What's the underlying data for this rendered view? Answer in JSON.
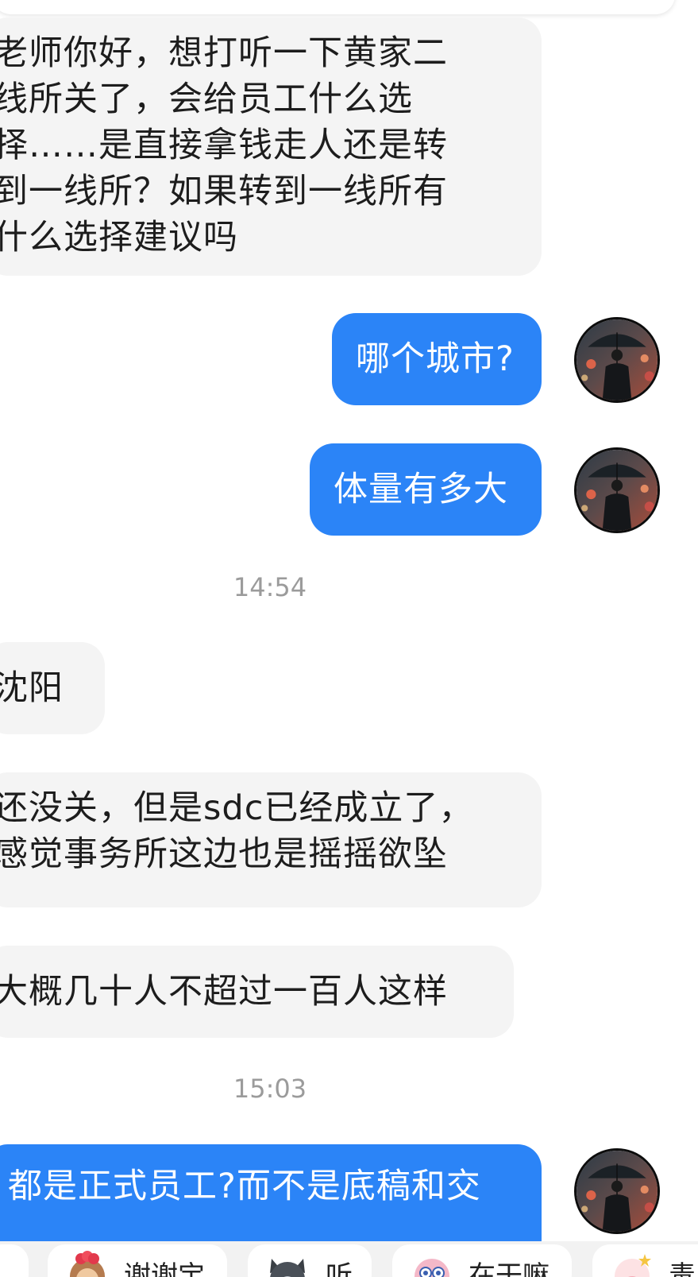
{
  "messages": {
    "m1": {
      "lines": [
        "老师你好，想打听一下黄家二",
        "线所关了，会给员工什么选",
        "择……是直接拿钱走人还是转",
        "到一线所？如果转到一线所有",
        "什么选择建议吗"
      ]
    },
    "m2": {
      "text": "哪个城市?"
    },
    "m3": {
      "text": "体量有多大"
    },
    "time1": "14:54",
    "m4": {
      "text": "沈阳"
    },
    "m5": {
      "lines": [
        "还没关，但是sdc已经成立了，",
        "感觉事务所这边也是摇摇欲坠"
      ]
    },
    "m6": {
      "text": "大概几十人不超过一百人这样"
    },
    "time2": "15:03",
    "m7": {
      "text": "都是正式员工?而不是底稿和交"
    }
  },
  "quick_replies": [
    {
      "label": "谢谢宝",
      "icon": "monkey-sticker-icon"
    },
    {
      "label": "听",
      "icon": "cat-sticker-icon"
    },
    {
      "label": "在干嘛",
      "icon": "pink-creature-sticker-icon"
    },
    {
      "label": "毒",
      "icon": "pig-sticker-icon"
    }
  ],
  "colors": {
    "outgoing_bubble": "#2b84f7",
    "incoming_bubble": "#f4f4f4",
    "timestamp": "#9b9b9b"
  },
  "avatar": {
    "icon": "man-with-umbrella-avatar"
  }
}
